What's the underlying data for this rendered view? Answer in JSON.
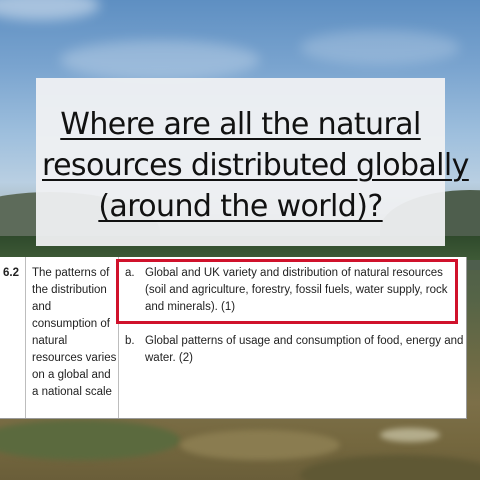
{
  "slide": {
    "title_lines": [
      "Where are all the natural",
      "resources distributed globally",
      "(around the world)?"
    ]
  },
  "spec_table": {
    "number": "6.2",
    "topic_lines": [
      "The patterns of",
      "the distribution",
      "and",
      "consumption of",
      "natural",
      "resources varies",
      "on a global and",
      "a national scale"
    ],
    "items": [
      {
        "marker": "a.",
        "lines": [
          "Global and UK variety and distribution of natural resources",
          "(soil and agriculture, forestry, fossil fuels, water supply, rock",
          "and minerals). (1)"
        ],
        "highlighted": true
      },
      {
        "marker": "b.",
        "lines": [
          "Global patterns of usage and consumption of food, energy and",
          "water. (2)"
        ],
        "highlighted": false
      }
    ]
  },
  "colors": {
    "highlight": "#d0112b",
    "title_box": "#f0f1f3"
  }
}
